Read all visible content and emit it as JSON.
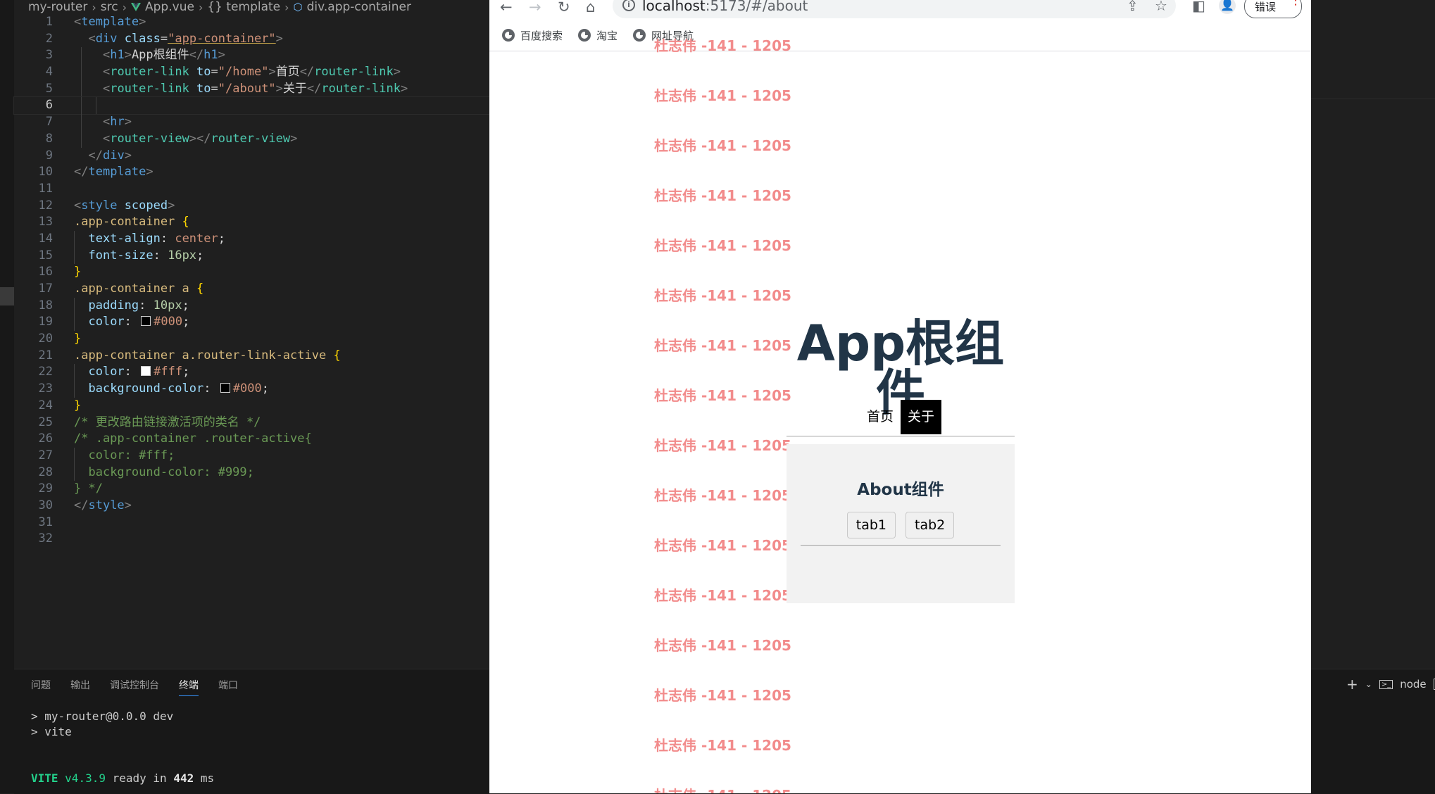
{
  "editor": {
    "breadcrumb": [
      "my-router",
      "src",
      "App.vue",
      "{} template",
      "div.app-container"
    ],
    "active_line": 6,
    "lines": [
      {
        "n": "1"
      },
      {
        "n": "2"
      },
      {
        "n": "3"
      },
      {
        "n": "4"
      },
      {
        "n": "5"
      },
      {
        "n": "6"
      },
      {
        "n": "7"
      },
      {
        "n": "8"
      },
      {
        "n": "9"
      },
      {
        "n": "10"
      },
      {
        "n": "11"
      },
      {
        "n": "12"
      },
      {
        "n": "13"
      },
      {
        "n": "14"
      },
      {
        "n": "15"
      },
      {
        "n": "16"
      },
      {
        "n": "17"
      },
      {
        "n": "18"
      },
      {
        "n": "19"
      },
      {
        "n": "20"
      },
      {
        "n": "21"
      },
      {
        "n": "22"
      },
      {
        "n": "23"
      },
      {
        "n": "24"
      },
      {
        "n": "25"
      },
      {
        "n": "26"
      },
      {
        "n": "27"
      },
      {
        "n": "28"
      },
      {
        "n": "29"
      },
      {
        "n": "30"
      },
      {
        "n": "31"
      },
      {
        "n": "32"
      }
    ],
    "code": {
      "tpl_open": "template",
      "div_tag": "div",
      "class_attr": "class",
      "class_val": "\"app-container\"",
      "h1_text": "App根组件",
      "h1_tag": "h1",
      "router_link": "router-link",
      "to_attr": "to",
      "home_val": "\"/home\"",
      "home_text": "首页",
      "about_val": "\"/about\"",
      "about_text": "关于",
      "hr_tag": "hr",
      "router_view": "router-view",
      "style_tag": "style",
      "scoped": "scoped",
      "sel1": ".app-container",
      "p_text_align": "text-align",
      "v_center": "center",
      "p_font_size": "font-size",
      "v_16px": "16px",
      "sel2": ".app-container a",
      "p_padding": "padding",
      "v_10px": "10px",
      "p_color": "color",
      "v_000": "#000",
      "sel3": ".app-container a.router-link-active",
      "v_fff": "#fff",
      "p_bg": "background-color",
      "c25": "/* 更改路由链接激活项的类名 */",
      "c26": "/* .app-container .router-active{",
      "c27": "color: #fff;",
      "c28": "background-color: #999;",
      "c29": "} */",
      "brace_open": "{",
      "brace_close": "}"
    }
  },
  "panel": {
    "tabs": [
      "问题",
      "输出",
      "调试控制台",
      "终端",
      "端口"
    ],
    "active_tab": "终端",
    "terminal": {
      "line1": "> my-router@0.0.0 dev",
      "line2": "> vite",
      "vite_label": "VITE",
      "vite_version": "v4.3.9",
      "ready_text": "ready in",
      "ready_ms": "442",
      "ms_unit": "ms"
    },
    "toolbar_node": "node"
  },
  "browser": {
    "url_host": "localhost",
    "url_rest": ":5173/#/about",
    "error_button": "错误",
    "bookmarks": [
      "百度搜索",
      "淘宝",
      "网址导航"
    ],
    "watermark_text": "杜志伟 -141 - 1205",
    "app": {
      "title": "App根组件",
      "link_home": "首页",
      "link_about": "关于",
      "about_title": "About组件",
      "tab1": "tab1",
      "tab2": "tab2"
    }
  },
  "colors": {
    "active_link_bg": "#000000",
    "title_color": "#213547",
    "watermark": "#f28b8b"
  }
}
